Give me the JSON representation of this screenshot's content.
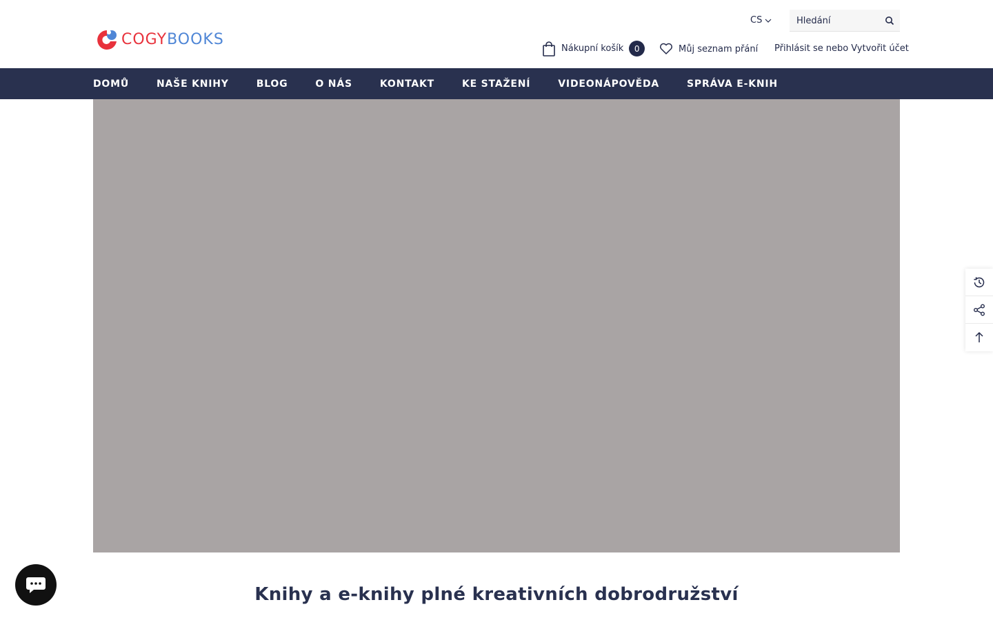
{
  "brand": {
    "logo_text_primary": "COGY",
    "logo_text_secondary": "BOOKS",
    "colors": {
      "primary_red": "#e8323c",
      "primary_blue": "#4f86d6",
      "navy": "#29314f"
    }
  },
  "header": {
    "language": "CS",
    "search": {
      "placeholder": "Hledání"
    },
    "cart": {
      "label": "Nákupní košík",
      "count": "0"
    },
    "wishlist": {
      "label": "Můj seznam přání"
    },
    "account": {
      "login": "Přihlásit se",
      "separator": "nebo",
      "register": "Vytvořit účet"
    }
  },
  "nav": {
    "items": [
      {
        "label": "DOMŮ"
      },
      {
        "label": "NAŠE KNIHY"
      },
      {
        "label": "BLOG"
      },
      {
        "label": "O NÁS"
      },
      {
        "label": "KONTAKT"
      },
      {
        "label": "KE STAŽENÍ"
      },
      {
        "label": "VIDEONÁPOVĚDA"
      },
      {
        "label": "SPRÁVA E-KNIH"
      }
    ]
  },
  "hero": {
    "background_color": "#a9a4a4"
  },
  "main": {
    "headline": "Knihy a e-knihy plné kreativních dobrodružství"
  },
  "side_tools": {
    "icons": [
      "recently-viewed-icon",
      "share-icon",
      "back-to-top-icon"
    ]
  },
  "chat": {
    "icon": "chat-bubble-icon"
  }
}
